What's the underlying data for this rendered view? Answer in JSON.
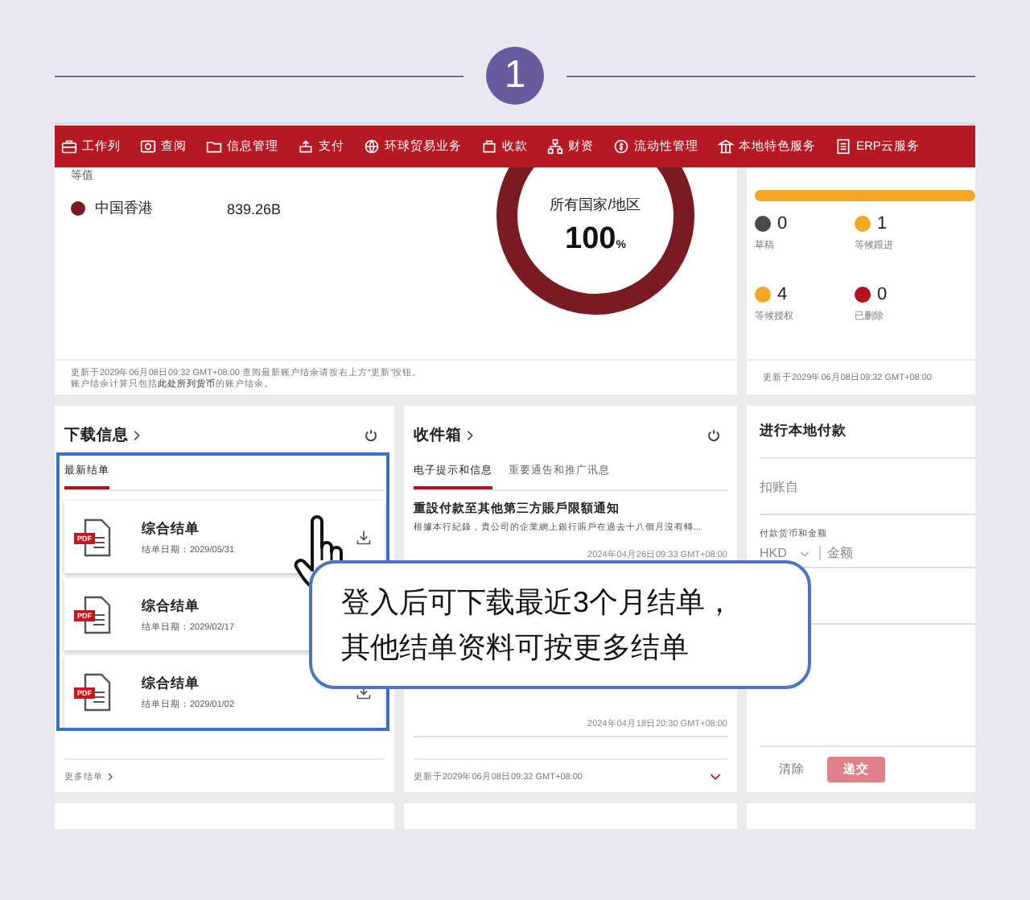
{
  "step": {
    "number": "1"
  },
  "nav": [
    {
      "label": "工作列"
    },
    {
      "label": "查阅"
    },
    {
      "label": "信息管理"
    },
    {
      "label": "支付"
    },
    {
      "label": "环球贸易业务"
    },
    {
      "label": "收款"
    },
    {
      "label": "财资"
    },
    {
      "label": "流动性管理"
    },
    {
      "label": "本地特色服务"
    },
    {
      "label": "ERP云服务"
    }
  ],
  "overview": {
    "caption": "等值",
    "legend": [
      {
        "name": "中国香港",
        "value": "839.26B",
        "color": "#7a1a22"
      }
    ],
    "center_title": "所有国家/地区",
    "center_value": "100",
    "center_unit": "%",
    "footer": [
      "更新于2029年06月08日09:32 GMT+08:00 查阅最新账户结余请按右上方“更新”按钮。",
      "账户结余计算只包括**此处所列货币**的账户结余。"
    ]
  },
  "tasks": {
    "progress": {
      "level": 1
    },
    "statuses": [
      {
        "count": "0",
        "label": "草稿",
        "color": "#4a4a4a"
      },
      {
        "count": "1",
        "label": "等候跟进",
        "color": "#f5a623"
      },
      {
        "count": "4",
        "label": "等候授权",
        "color": "#f5a623"
      },
      {
        "count": "0",
        "label": "已删除",
        "color": "#b3121e"
      }
    ],
    "footer": "更新于2029年06月08日09:32 GMT+08:00"
  },
  "downloads": {
    "title": "下载信息",
    "tabs": [
      {
        "label": "最新结单",
        "selected": true
      }
    ],
    "statements": [
      {
        "file_type": "PDF",
        "title": "综合结单",
        "date": "结单日期：2029/05/31"
      },
      {
        "file_type": "PDF",
        "title": "综合结单",
        "date": "结单日期：2029/02/17"
      },
      {
        "file_type": "PDF",
        "title": "综合结单",
        "date": "结单日期：2029/01/02"
      }
    ],
    "more": "更多结单"
  },
  "inbox": {
    "title": "收件箱",
    "tabs": [
      {
        "label": "电子提示和信息",
        "selected": true
      },
      {
        "label": "重要通告和推广讯息",
        "selected": false
      }
    ],
    "messages": [
      {
        "title": "重設付款至其他第三方賬戶限額通知",
        "body": "根據本行紀錄，貴公司的企業網上銀行賬戶在過去十八個月沒有轉...",
        "time": "2024年04月26日09:33 GMT+08:00"
      },
      {
        "time": "2024年04月18日20:30 GMT+08:00"
      }
    ],
    "footer": "更新于2029年06月08日09:32 GMT+08:00"
  },
  "payment": {
    "title": "进行本地付款",
    "debit_placeholder": "扣账自",
    "currency_label": "付款货币和金额",
    "currency": "HKD",
    "amount_placeholder": "金额",
    "buttons": [
      {
        "label": "清除",
        "kind": "text"
      },
      {
        "label": "递交",
        "kind": "primary",
        "disabled": true
      }
    ]
  },
  "callout": [
    "登入后可下载最近3个月结单，",
    "其他结单资料可按更多结单"
  ]
}
